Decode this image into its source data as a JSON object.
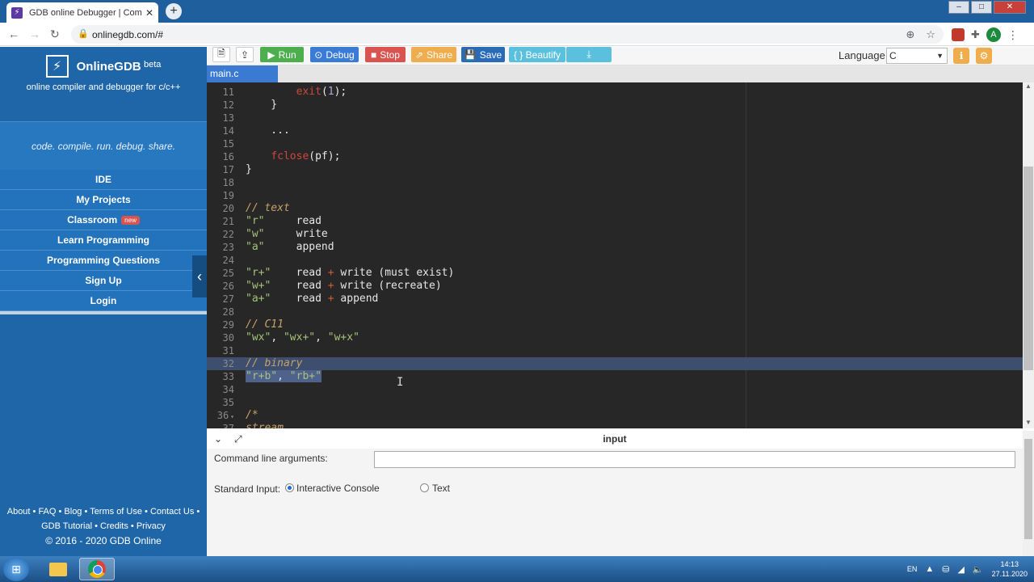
{
  "browser": {
    "tab_title": "GDB online Debugger | Compile",
    "tab_close": "✕",
    "new_tab": "+",
    "url": "onlinegdb.com/#",
    "avatar_letter": "A",
    "window_controls": [
      "–",
      "□",
      "✕"
    ]
  },
  "sidebar": {
    "logo_name": "OnlineGDB",
    "logo_beta": "beta",
    "logo_sub": "online compiler and debugger for c/c++",
    "tagline": "code. compile. run. debug. share.",
    "items": [
      {
        "label": "IDE"
      },
      {
        "label": "My Projects"
      },
      {
        "label": "Classroom",
        "badge": "new"
      },
      {
        "label": "Learn Programming"
      },
      {
        "label": "Programming Questions"
      },
      {
        "label": "Sign Up"
      },
      {
        "label": "Login"
      }
    ],
    "footer_line1": "About • FAQ • Blog • Terms of Use • Contact Us •",
    "footer_line2": "GDB Tutorial • Credits • Privacy",
    "footer_copy": "© 2016 - 2020 GDB Online"
  },
  "toolbar": {
    "run": "Run",
    "debug": "Debug",
    "stop": "Stop",
    "share": "Share",
    "save": "Save",
    "beautify": "{ } Beautify",
    "language_label": "Language",
    "language_value": "C"
  },
  "colors": {
    "run": "#4cae4c",
    "debug": "#3a7bd5",
    "stop": "#d9534f",
    "share": "#f0ad4e",
    "save": "#2a6bb8",
    "beautify": "#5bc0de",
    "download": "#5bc0de"
  },
  "file_tab": "main.c",
  "editor": {
    "lines": [
      {
        "n": "11",
        "html": "        <span class=\"c-fn\">exit</span>(<span class=\"c-num\">1</span>);"
      },
      {
        "n": "12",
        "html": "    }"
      },
      {
        "n": "13",
        "html": ""
      },
      {
        "n": "14",
        "html": "    ..."
      },
      {
        "n": "15",
        "html": ""
      },
      {
        "n": "16",
        "html": "    <span class=\"c-fn\">fclose</span>(pf);"
      },
      {
        "n": "17",
        "html": "}"
      },
      {
        "n": "18",
        "html": ""
      },
      {
        "n": "19",
        "html": ""
      },
      {
        "n": "20",
        "html": "<span class=\"c-com\">// text</span>"
      },
      {
        "n": "21",
        "html": "<span class=\"c-str\">\"r\"</span>     read"
      },
      {
        "n": "22",
        "html": "<span class=\"c-str\">\"w\"</span>     write"
      },
      {
        "n": "23",
        "html": "<span class=\"c-str\">\"a\"</span>     append"
      },
      {
        "n": "24",
        "html": ""
      },
      {
        "n": "25",
        "html": "<span class=\"c-str\">\"r+\"</span>    read <span class=\"c-op\">+</span> write (must exist)"
      },
      {
        "n": "26",
        "html": "<span class=\"c-str\">\"w+\"</span>    read <span class=\"c-op\">+</span> write (recreate)"
      },
      {
        "n": "27",
        "html": "<span class=\"c-str\">\"a+\"</span>    read <span class=\"c-op\">+</span> append"
      },
      {
        "n": "28",
        "html": ""
      },
      {
        "n": "29",
        "html": "<span class=\"c-com\">// C11</span>"
      },
      {
        "n": "30",
        "html": "<span class=\"c-str\">\"wx\"</span>, <span class=\"c-str\">\"wx+\"</span>, <span class=\"c-str\">\"w+x\"</span>"
      },
      {
        "n": "31",
        "html": ""
      },
      {
        "n": "32",
        "html": "<span class=\"c-com\">// binary</span>",
        "sel": true
      },
      {
        "n": "33",
        "html": "<span class=\"sel-text\"><span class=\"c-str\">\"r+b\"</span>, <span class=\"c-str\">\"rb+\"</span></span>"
      },
      {
        "n": "34",
        "html": ""
      },
      {
        "n": "35",
        "html": ""
      },
      {
        "n": "36",
        "html": "<span class=\"c-com\">/*</span>",
        "fold": true
      },
      {
        "n": "37",
        "html": "<span class=\"c-com\">stream</span>"
      }
    ]
  },
  "input_panel": {
    "title": "input",
    "cla_label": "Command line arguments:",
    "stdin_label": "Standard Input:",
    "opt_console": "Interactive Console",
    "opt_text": "Text"
  },
  "taskbar": {
    "lang": "EN",
    "time": "14:13",
    "date": "27.11.2020"
  }
}
